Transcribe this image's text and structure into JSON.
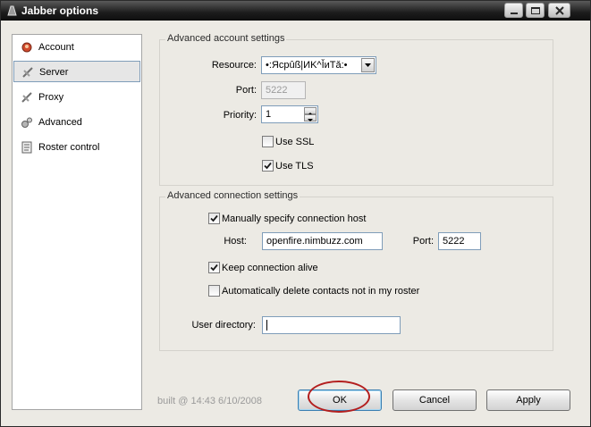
{
  "window": {
    "title": "Jabber options"
  },
  "sidebar": {
    "items": [
      {
        "label": "Account",
        "icon": "account-icon"
      },
      {
        "label": "Server",
        "icon": "server-icon",
        "selected": true
      },
      {
        "label": "Proxy",
        "icon": "proxy-icon"
      },
      {
        "label": "Advanced",
        "icon": "gears-icon"
      },
      {
        "label": "Roster control",
        "icon": "roster-icon"
      }
    ]
  },
  "account_settings": {
    "title": "Advanced account settings",
    "resource_label": "Resource:",
    "resource_value": "•:Ясрûß|ИK^ǏиТǎ:•",
    "port_label": "Port:",
    "port_value": "5222",
    "priority_label": "Priority:",
    "priority_value": "1",
    "use_ssl_label": "Use SSL",
    "use_ssl_checked": false,
    "use_tls_label": "Use TLS",
    "use_tls_checked": true
  },
  "connection_settings": {
    "title": "Advanced connection settings",
    "manual_host_label": "Manually specify connection host",
    "manual_host_checked": true,
    "host_label": "Host:",
    "host_value": "openfire.nimbuzz.com",
    "port_label": "Port:",
    "port_value": "5222",
    "keep_alive_label": "Keep connection alive",
    "keep_alive_checked": true,
    "auto_delete_label": "Automatically delete contacts not in my roster",
    "auto_delete_checked": false,
    "user_directory_label": "User directory:",
    "user_directory_value": ""
  },
  "footer": {
    "build_text": "built @ 14:43 6/10/2008",
    "ok_label": "OK",
    "cancel_label": "Cancel",
    "apply_label": "Apply"
  },
  "colors": {
    "annotation": "#b31e1e",
    "focus_border": "#3c7fb1",
    "selected_border": "#7f9db9"
  }
}
